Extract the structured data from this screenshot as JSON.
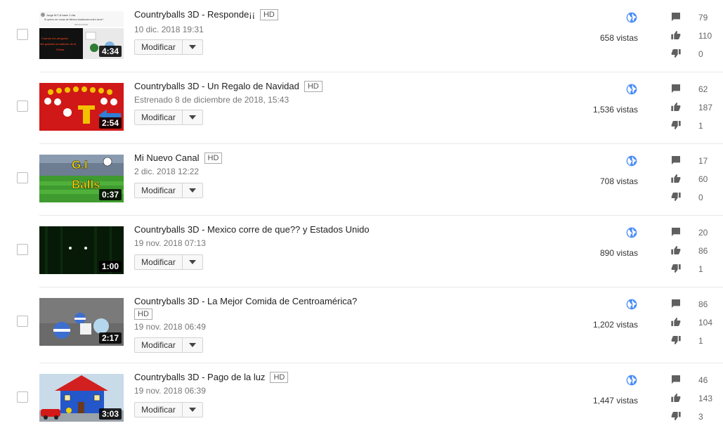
{
  "videos": [
    {
      "title": "Countryballs 3D - Responde¡¡",
      "hd": "HD",
      "hd_own_line": false,
      "date": "10 dic. 2018 19:31",
      "duration": "4:34",
      "edit_label": "Modificar",
      "views": "658 vistas",
      "comments": "79",
      "likes": "110",
      "dislikes": "0",
      "thumbnail_texts": [
        "Jorge M.T.A hace 1 día",
        "Si quiero ver cosas de México tradiciones entre otros?",
        "RESPONDER",
        "Cuando me pregunta",
        "Me gustaba la tradicion de la",
        "Piñata"
      ]
    },
    {
      "title": "Countryballs 3D - Un Regalo de Navidad",
      "hd": "HD",
      "hd_own_line": false,
      "date": "Estrenado 8 de diciembre de 2018, 15:43",
      "duration": "2:54",
      "edit_label": "Modificar",
      "views": "1,536 vistas",
      "comments": "62",
      "likes": "187",
      "dislikes": "1"
    },
    {
      "title": "Mi Nuevo Canal",
      "hd": "HD",
      "hd_own_line": false,
      "date": "2 dic. 2018 12:22",
      "duration": "0:37",
      "edit_label": "Modificar",
      "views": "708 vistas",
      "comments": "17",
      "likes": "60",
      "dislikes": "0",
      "thumbnail_texts": [
        "G.I",
        "Balls"
      ]
    },
    {
      "title": "Countryballs 3D - Mexico corre de que?? y Estados Unido",
      "hd": "",
      "hd_own_line": false,
      "date": "19 nov. 2018 07:13",
      "duration": "1:00",
      "edit_label": "Modificar",
      "views": "890 vistas",
      "comments": "20",
      "likes": "86",
      "dislikes": "1"
    },
    {
      "title": "Countryballs 3D - La Mejor Comida de Centroamérica?",
      "hd": "HD",
      "hd_own_line": true,
      "date": "19 nov. 2018 06:49",
      "duration": "2:17",
      "edit_label": "Modificar",
      "views": "1,202 vistas",
      "comments": "86",
      "likes": "104",
      "dislikes": "1"
    },
    {
      "title": "Countryballs 3D - Pago de la luz",
      "hd": "HD",
      "hd_own_line": false,
      "date": "19 nov. 2018 06:39",
      "duration": "3:03",
      "edit_label": "Modificar",
      "views": "1,447 vistas",
      "comments": "46",
      "likes": "143",
      "dislikes": "3"
    }
  ],
  "colors": {
    "globe": "#4a8df8",
    "icon": "#606060",
    "hd_border": "#aaaaaa"
  }
}
